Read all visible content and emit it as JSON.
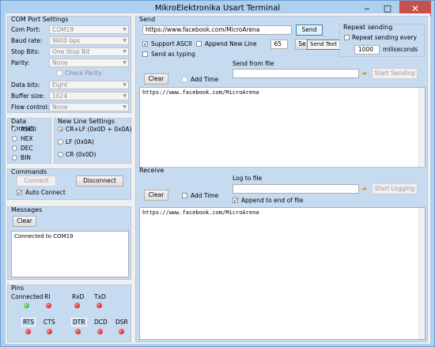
{
  "window": {
    "title": "MikroElektronika Usart Terminal",
    "minimize": "‒",
    "maximize": "□",
    "close": "✕"
  },
  "com": {
    "title": "COM Port Settings",
    "port_label": "Com Port:",
    "port_value": "COM19",
    "baud_label": "Baud rate:",
    "baud_value": "9600 bps",
    "stop_label": "Stop Bits:",
    "stop_value": "One Stop Bit",
    "parity_label": "Parity:",
    "parity_value": "None",
    "check_parity": "Check Parity",
    "data_label": "Data bits:",
    "data_value": "Eight",
    "buffer_label": "Buffer size:",
    "buffer_value": "1024",
    "flow_label": "Flow control:",
    "flow_value": "None"
  },
  "data_format": {
    "title": "Data Format",
    "options": [
      "ASCII",
      "HEX",
      "DEC",
      "BIN"
    ],
    "selected": "ASCII"
  },
  "new_line": {
    "title": "New Line Settings",
    "options": [
      "CR+LF (0x0D + 0x0A)",
      "LF (0x0A)",
      "CR (0x0D)"
    ],
    "selected": "CR+LF (0x0D + 0x0A)"
  },
  "commands": {
    "title": "Commands",
    "connect": "Connect",
    "disconnect": "Disconnect",
    "auto_connect": "Auto Connect"
  },
  "messages": {
    "title": "Messages",
    "clear": "Clear",
    "text": "Connected to COM19"
  },
  "pins": {
    "title": "Pins",
    "row1": [
      {
        "label": "Connected",
        "color": "green"
      },
      {
        "label": "RI",
        "color": "red"
      },
      {
        "label": "RxD",
        "color": "red"
      },
      {
        "label": "TxD",
        "color": "red"
      }
    ],
    "row2": [
      {
        "label": "RTS",
        "color": "red"
      },
      {
        "label": "CTS",
        "color": "red"
      },
      {
        "label": "DTR",
        "color": "red"
      },
      {
        "label": "DCD",
        "color": "red"
      },
      {
        "label": "DSR",
        "color": "red"
      }
    ]
  },
  "send": {
    "title": "Send",
    "input_value": "https://www.facebook.com/MicroArena",
    "send_button": "Send",
    "support_ascii": "Support ASCII",
    "append_new_line": "Append New Line",
    "ascii_value": "65",
    "se_button": "Se",
    "tooltip": "Send Text",
    "send_as_typing": "Send as typing",
    "clear": "Clear",
    "add_time": "Add Time",
    "send_from_file": "Send from file",
    "start_sending": "Start Sending",
    "content": "https://www.facebook.com/MicroArena"
  },
  "repeat": {
    "title": "Repeat sending",
    "repeat_every": "Repeat sending every",
    "interval": "1000",
    "unit": "miliseconds"
  },
  "receive": {
    "title": "Receive",
    "clear": "Clear",
    "add_time": "Add Time",
    "log_to_file": "Log to file",
    "start_logging": "Start Logging",
    "append_end": "Append to end of file",
    "content": "https://www.facebook.com/MicroArena"
  }
}
